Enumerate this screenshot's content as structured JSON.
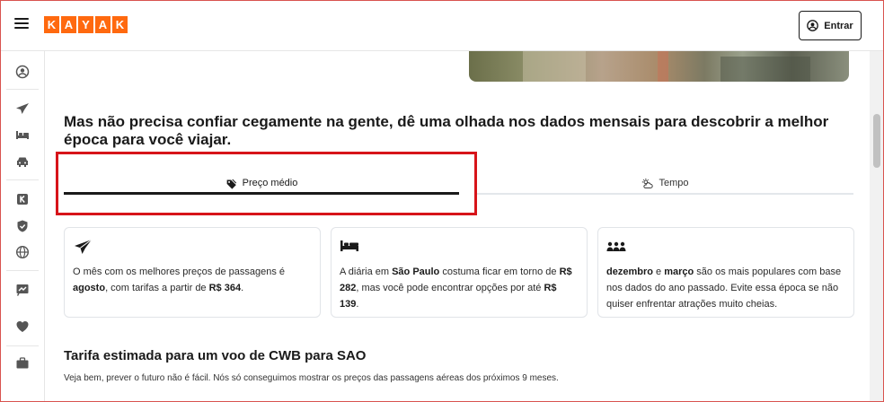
{
  "header": {
    "logo_letters": [
      "K",
      "A",
      "Y",
      "A",
      "K"
    ],
    "signin_label": "Entrar",
    "brand_color": "#ff690f"
  },
  "rail": {
    "icons": [
      "user-icon",
      "plane-icon",
      "bed-icon",
      "car-icon",
      "kayak-icon",
      "shield-icon",
      "globe-icon",
      "chart-icon",
      "heart-icon",
      "briefcase-icon"
    ]
  },
  "main": {
    "headline": "Mas não precisa confiar cegamente na gente, dê uma olhada nos dados mensais para descobrir a melhor época para você viajar.",
    "tabs": [
      {
        "label": "Preço médio",
        "icon": "price-tag-icon",
        "active": true
      },
      {
        "label": "Tempo",
        "icon": "weather-icon",
        "active": false
      }
    ],
    "cards": [
      {
        "icon": "plane-icon",
        "parts": [
          "O mês com os melhores preços de passagens é ",
          "agosto",
          ", com tarifas a partir de ",
          "R$ 364",
          "."
        ]
      },
      {
        "icon": "bed-icon",
        "parts": [
          "A diária em ",
          "São Paulo",
          " costuma ficar em torno de ",
          "R$ 282",
          ", mas você pode encontrar opções por até ",
          "R$ 139",
          "."
        ]
      },
      {
        "icon": "people-icon",
        "parts": [
          "dezembro",
          " e ",
          "março",
          " são os mais populares com base nos dados do ano passado. Evite essa época se não quiser enfrentar atrações muito cheias."
        ]
      }
    ],
    "subhead": "Tarifa estimada para um voo de CWB para SAO",
    "note": "Veja bem, prever o futuro não é fácil. Nós só conseguimos mostrar os preços das passagens aéreas dos próximos 9 meses."
  }
}
